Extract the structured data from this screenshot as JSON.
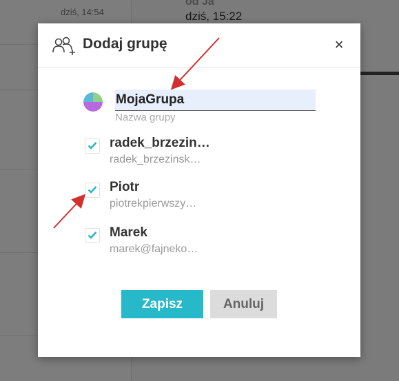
{
  "background": {
    "time_label": "dziś, 14:54",
    "from_label": "od Ja",
    "date_label": "dziś, 15:22"
  },
  "dialog": {
    "title": "Dodaj grupę",
    "title_icon": "add-group-icon",
    "close_icon": "close-icon",
    "close_label": "×",
    "group_name_value": "MojaGrupa",
    "group_name_hint": "Nazwa grupy",
    "members": [
      {
        "name": "radek_brzezin…",
        "email": "radek_brzezinsk…",
        "checked": true
      },
      {
        "name": "Piotr",
        "email": "piotrekpierwszy…",
        "checked": true
      },
      {
        "name": "Marek",
        "email": "marek@fajneko…",
        "checked": true
      }
    ],
    "save_label": "Zapisz",
    "cancel_label": "Anuluj"
  },
  "colors": {
    "accent": "#27b9c9",
    "checkmark": "#27b9c9",
    "annotation_arrow": "#d32f2f"
  }
}
